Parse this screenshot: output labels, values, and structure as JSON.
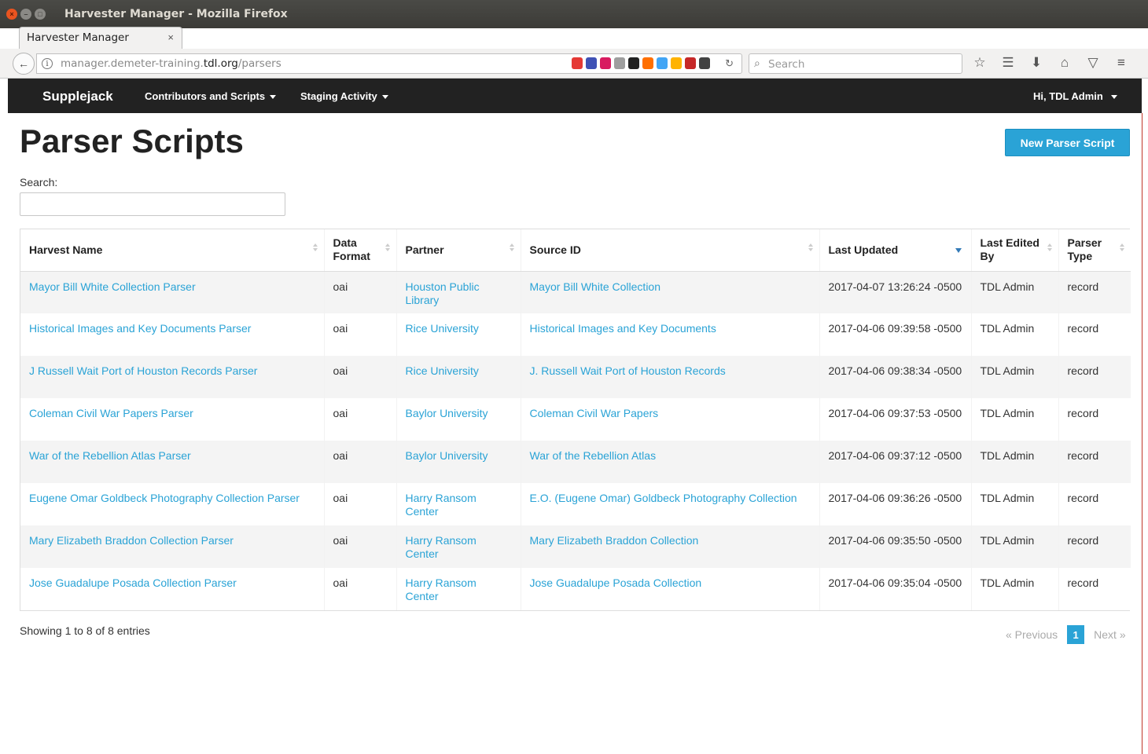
{
  "window": {
    "title": "Harvester Manager - Mozilla Firefox"
  },
  "browser": {
    "tab_title": "Harvester Manager",
    "url_prefix": "manager.demeter-training.",
    "url_domain": "tdl.org",
    "url_path": "/parsers",
    "search_placeholder": "Search",
    "extension_colors": [
      "#e53935",
      "#3f51b5",
      "#d81b60",
      "#9e9e9e",
      "#212121",
      "#ff6f00",
      "#42a5f5",
      "#ffb300",
      "#c62828",
      "#424242"
    ]
  },
  "nav": {
    "brand": "Supplejack",
    "menu1": "Contributors and Scripts",
    "menu2": "Staging Activity",
    "user": "Hi, TDL Admin"
  },
  "page": {
    "title": "Parser Scripts",
    "new_button": "New Parser Script",
    "search_label": "Search:"
  },
  "table": {
    "columns": {
      "harvest_name": "Harvest Name",
      "data_format": "Data Format",
      "partner": "Partner",
      "source_id": "Source ID",
      "last_updated": "Last Updated",
      "last_edited_by": "Last Edited By",
      "parser_type": "Parser Type"
    },
    "rows": [
      {
        "name": "Mayor Bill White Collection Parser",
        "format": "oai",
        "partner": "Houston Public Library",
        "source": "Mayor Bill White Collection",
        "updated": "2017-04-07 13:26:24 -0500",
        "editor": "TDL Admin",
        "type": "record"
      },
      {
        "name": "Historical Images and Key Documents Parser",
        "format": "oai",
        "partner": "Rice University",
        "source": "Historical Images and Key Documents",
        "updated": "2017-04-06 09:39:58 -0500",
        "editor": "TDL Admin",
        "type": "record"
      },
      {
        "name": "J Russell Wait Port of Houston Records Parser",
        "format": "oai",
        "partner": "Rice University",
        "source": "J. Russell Wait Port of Houston Records",
        "updated": "2017-04-06 09:38:34 -0500",
        "editor": "TDL Admin",
        "type": "record"
      },
      {
        "name": "Coleman Civil War Papers Parser",
        "format": "oai",
        "partner": "Baylor University",
        "source": "Coleman Civil War Papers",
        "updated": "2017-04-06 09:37:53 -0500",
        "editor": "TDL Admin",
        "type": "record"
      },
      {
        "name": "War of the Rebellion Atlas Parser",
        "format": "oai",
        "partner": "Baylor University",
        "source": "War of the Rebellion Atlas",
        "updated": "2017-04-06 09:37:12 -0500",
        "editor": "TDL Admin",
        "type": "record"
      },
      {
        "name": "Eugene Omar Goldbeck Photography Collection Parser",
        "format": "oai",
        "partner": "Harry Ransom Center",
        "source": "E.O. (Eugene Omar) Goldbeck Photography Collection",
        "updated": "2017-04-06 09:36:26 -0500",
        "editor": "TDL Admin",
        "type": "record"
      },
      {
        "name": "Mary Elizabeth Braddon Collection Parser",
        "format": "oai",
        "partner": "Harry Ransom Center",
        "source": "Mary Elizabeth Braddon Collection",
        "updated": "2017-04-06 09:35:50 -0500",
        "editor": "TDL Admin",
        "type": "record"
      },
      {
        "name": "Jose Guadalupe Posada Collection Parser",
        "format": "oai",
        "partner": "Harry Ransom Center",
        "source": "Jose Guadalupe Posada Collection",
        "updated": "2017-04-06 09:35:04 -0500",
        "editor": "TDL Admin",
        "type": "record"
      }
    ]
  },
  "footer": {
    "showing": "Showing 1 to 8 of 8 entries",
    "previous": "« Previous",
    "current_page": "1",
    "next": "Next »"
  },
  "colors": {
    "link": "#2aa3d6",
    "navbar": "#222222",
    "primary_button": "#2aa3d6"
  }
}
